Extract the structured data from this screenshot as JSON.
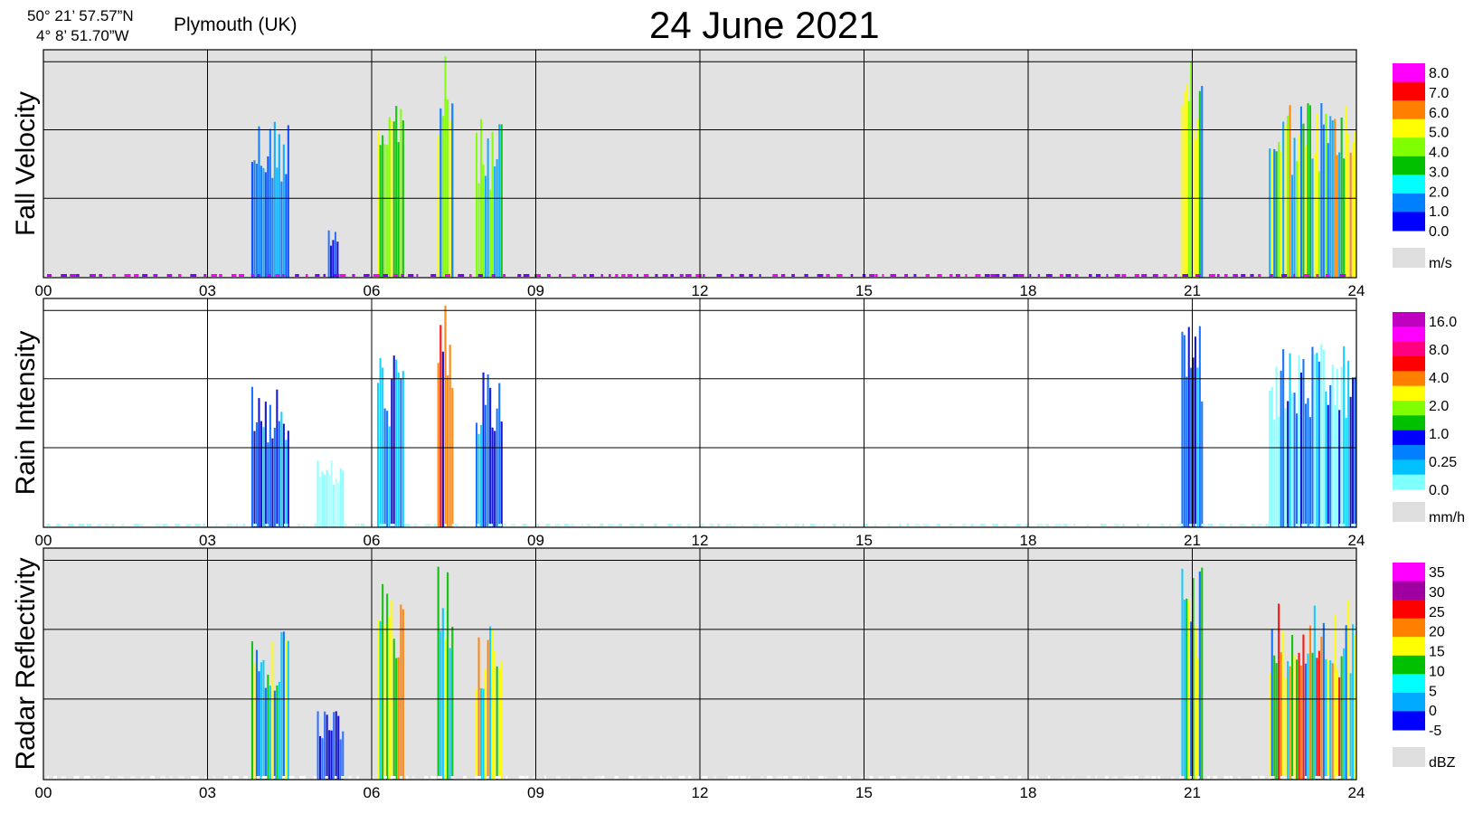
{
  "header": {
    "coord_lat": "50° 21’ 57.57”N",
    "coord_lon": "4°  8’ 51.70”W",
    "site": "Plymouth (UK)",
    "title": "24 June  2021"
  },
  "chart_data": [
    {
      "type": "heatmap",
      "ylabel": "Fall Velocity",
      "xlabel": "",
      "x_ticks": [
        "00",
        "03",
        "06",
        "09",
        "12",
        "15",
        "18",
        "21",
        "24"
      ],
      "xlim": [
        0,
        24
      ],
      "background": "#e2e2e2",
      "legend_unit": "m/s",
      "legend_labels": [
        "8.0",
        "7.0",
        "6.0",
        "5.0",
        "4.0",
        "3.0",
        "2.0",
        "1.0",
        "0.0"
      ],
      "legend_colors": [
        "#ff00ff",
        "#ff0000",
        "#ff8000",
        "#ffff00",
        "#80ff00",
        "#00c000",
        "#00ffff",
        "#0080ff",
        "#0000ff"
      ],
      "events": [
        {
          "start": 3.8,
          "end": 4.5,
          "top": 0.72,
          "colors": [
            "#0044ff",
            "#00aaff",
            "#0077ff"
          ]
        },
        {
          "start": 5.2,
          "end": 5.4,
          "top": 0.25,
          "colors": [
            "#0000dd",
            "#2266ff"
          ]
        },
        {
          "start": 6.1,
          "end": 6.6,
          "top": 0.85,
          "colors": [
            "#00c000",
            "#80ff00",
            "#00aaff",
            "#ffff00"
          ]
        },
        {
          "start": 7.2,
          "end": 7.5,
          "top": 0.98,
          "colors": [
            "#00c000",
            "#ffff00",
            "#80ff00",
            "#0077ff"
          ]
        },
        {
          "start": 7.9,
          "end": 8.4,
          "top": 0.7,
          "colors": [
            "#00c000",
            "#80ff00",
            "#00aaff"
          ]
        },
        {
          "start": 20.8,
          "end": 21.2,
          "top": 0.95,
          "colors": [
            "#00c000",
            "#80ff00",
            "#0077ff",
            "#ffff00"
          ]
        },
        {
          "start": 22.4,
          "end": 24.0,
          "top": 0.8,
          "colors": [
            "#00c000",
            "#80ff00",
            "#ffff00",
            "#ff8000",
            "#00aaff",
            "#0077ff"
          ]
        }
      ]
    },
    {
      "type": "heatmap",
      "ylabel": "Rain Intensity",
      "xlabel": "",
      "x_ticks": [
        "00",
        "03",
        "06",
        "09",
        "12",
        "15",
        "18",
        "21",
        "24"
      ],
      "xlim": [
        0,
        24
      ],
      "background": "#ffffff",
      "legend_unit": "mm/h",
      "legend_labels": [
        "16.0",
        "8.0",
        "4.0",
        "2.0",
        "1.0",
        "0.25",
        "0.0"
      ],
      "legend_colors": [
        "#c000c0",
        "#ff00ff",
        "#ff0080",
        "#ff0000",
        "#ff8000",
        "#ffff00",
        "#80ff00",
        "#00c000",
        "#0000ff",
        "#0080ff",
        "#00c0ff",
        "#80ffff"
      ],
      "events": [
        {
          "start": 3.8,
          "end": 4.5,
          "top": 0.65,
          "colors": [
            "#00ccff",
            "#0066ff",
            "#0000cc"
          ]
        },
        {
          "start": 5.0,
          "end": 5.5,
          "top": 0.3,
          "colors": [
            "#80ffff",
            "#aaffff"
          ]
        },
        {
          "start": 6.1,
          "end": 6.6,
          "top": 0.78,
          "colors": [
            "#0000cc",
            "#0066ff",
            "#00ccff"
          ]
        },
        {
          "start": 7.2,
          "end": 7.5,
          "top": 0.98,
          "colors": [
            "#0000cc",
            "#0066ff",
            "#ff0000",
            "#ff8000"
          ]
        },
        {
          "start": 7.9,
          "end": 8.4,
          "top": 0.68,
          "colors": [
            "#0000cc",
            "#0066ff",
            "#00ccff"
          ]
        },
        {
          "start": 20.8,
          "end": 21.2,
          "top": 0.95,
          "colors": [
            "#0000cc",
            "#0066ff",
            "#00ccff"
          ]
        },
        {
          "start": 22.4,
          "end": 24.0,
          "top": 0.8,
          "colors": [
            "#80ffff",
            "#00ccff",
            "#0066ff",
            "#0000cc"
          ]
        }
      ]
    },
    {
      "type": "heatmap",
      "ylabel": "Radar Reflectivity",
      "xlabel": "",
      "x_ticks": [
        "00",
        "03",
        "06",
        "09",
        "12",
        "15",
        "18",
        "21",
        "24"
      ],
      "xlim": [
        0,
        24
      ],
      "background": "#e2e2e2",
      "legend_unit": "dBZ",
      "legend_labels": [
        "35",
        "30",
        "25",
        "20",
        "15",
        "10",
        "5",
        "0",
        "-5"
      ],
      "legend_colors": [
        "#ff00ff",
        "#a000a0",
        "#ff0000",
        "#ff8000",
        "#ffff00",
        "#00c000",
        "#00ffff",
        "#00aaff",
        "#0000ff"
      ],
      "events": [
        {
          "start": 3.8,
          "end": 4.5,
          "top": 0.65,
          "colors": [
            "#00ccff",
            "#00c000",
            "#ffff00",
            "#0066ff"
          ]
        },
        {
          "start": 5.0,
          "end": 5.5,
          "top": 0.3,
          "colors": [
            "#0000cc",
            "#2266ff"
          ]
        },
        {
          "start": 6.1,
          "end": 6.6,
          "top": 0.85,
          "colors": [
            "#00c000",
            "#ffff00",
            "#00ccff",
            "#ff8000"
          ]
        },
        {
          "start": 7.2,
          "end": 7.5,
          "top": 0.98,
          "colors": [
            "#00c000",
            "#ffff00",
            "#ff8000",
            "#00ccff"
          ]
        },
        {
          "start": 7.9,
          "end": 8.4,
          "top": 0.7,
          "colors": [
            "#00c000",
            "#ffff00",
            "#00ccff",
            "#ff8000"
          ]
        },
        {
          "start": 20.8,
          "end": 21.2,
          "top": 0.95,
          "colors": [
            "#00c000",
            "#ffff00",
            "#00ccff",
            "#0066ff"
          ]
        },
        {
          "start": 22.4,
          "end": 24.0,
          "top": 0.8,
          "colors": [
            "#00c000",
            "#ffff00",
            "#ff8000",
            "#ff0000",
            "#00ccff",
            "#0066ff"
          ]
        }
      ]
    }
  ]
}
